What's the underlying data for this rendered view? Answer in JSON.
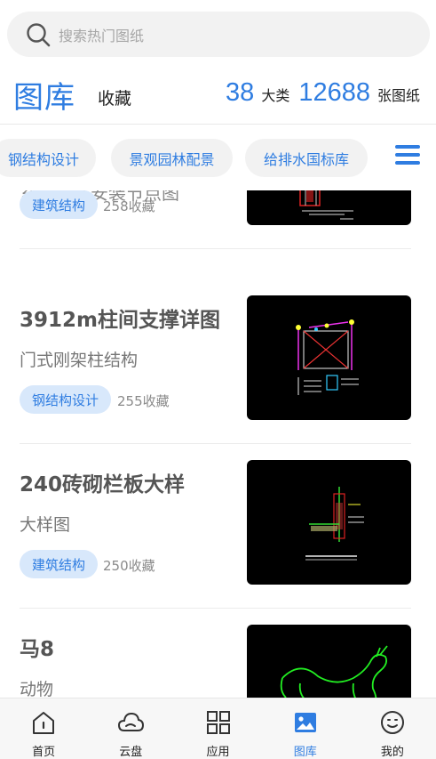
{
  "search": {
    "placeholder": "搜索热门图纸"
  },
  "header": {
    "title": "图库",
    "favorites_label": "收藏",
    "category_count": "38",
    "category_unit": "大类",
    "drawing_count": "12688",
    "drawing_unit": "张图纸"
  },
  "chips": [
    "钢结构设计",
    "景观园林配景",
    "给排水国标库"
  ],
  "list": [
    {
      "title": "室外构件安装节点图",
      "tag": "建筑结构",
      "favorites": "258收藏"
    },
    {
      "title": "3912m柱间支撑详图",
      "subtitle": "门式刚架柱结构",
      "tag": "钢结构设计",
      "favorites": "255收藏"
    },
    {
      "title": "240砖砌栏板大样",
      "subtitle": "大样图",
      "tag": "建筑结构",
      "favorites": "250收藏"
    },
    {
      "title": "马8",
      "subtitle": "动物"
    }
  ],
  "nav": [
    {
      "label": "首页",
      "icon": "home-icon"
    },
    {
      "label": "云盘",
      "icon": "cloud-icon"
    },
    {
      "label": "应用",
      "icon": "apps-grid-icon"
    },
    {
      "label": "图库",
      "icon": "gallery-icon"
    },
    {
      "label": "我的",
      "icon": "profile-smile-icon"
    }
  ],
  "colors": {
    "accent": "#2f7de1",
    "tag_bg": "#d8e8fb",
    "chip_bg": "#f2f2f2"
  }
}
